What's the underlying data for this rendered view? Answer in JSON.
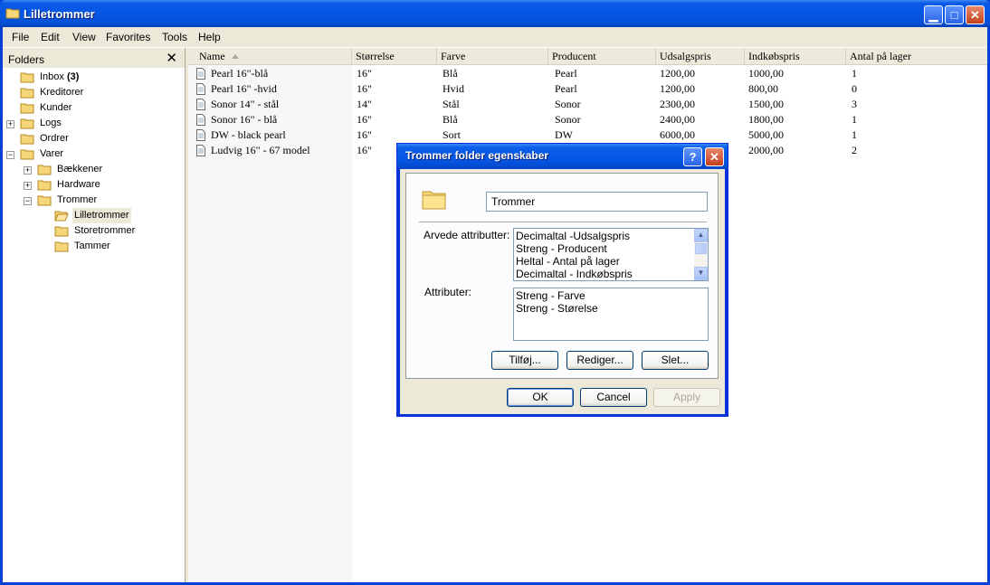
{
  "window": {
    "title": "Lilletrommer"
  },
  "menu": [
    "File",
    "Edit",
    "View",
    "Favorites",
    "Tools",
    "Help"
  ],
  "folders": {
    "title": "Folders",
    "close_glyph": "✕",
    "tree": [
      {
        "label": "Inbox",
        "count": "(3)"
      },
      {
        "label": "Kreditorer"
      },
      {
        "label": "Kunder"
      },
      {
        "label": "Logs"
      },
      {
        "label": "Ordrer"
      },
      {
        "label": "Varer"
      },
      {
        "label": "Bækkener"
      },
      {
        "label": "Hardware"
      },
      {
        "label": "Trommer"
      },
      {
        "label": "Lilletrommer"
      },
      {
        "label": "Storetrommer"
      },
      {
        "label": "Tammer"
      }
    ]
  },
  "table": {
    "columns": [
      "Name",
      "Størrelse",
      "Farve",
      "Producent",
      "Udsalgspris",
      "Indkøbspris",
      "Antal på lager"
    ],
    "rows": [
      [
        "Pearl 16\"-blå",
        "16\"",
        "Blå",
        "Pearl",
        "1200,00",
        "1000,00",
        "1"
      ],
      [
        "Pearl 16\" -hvid",
        "16\"",
        "Hvid",
        "Pearl",
        "1200,00",
        "800,00",
        "0"
      ],
      [
        "Sonor 14\" - stål",
        "14\"",
        "Stål",
        "Sonor",
        "2300,00",
        "1500,00",
        "3"
      ],
      [
        "Sonor 16\" - blå",
        "16\"",
        "Blå",
        "Sonor",
        "2400,00",
        "1800,00",
        "1"
      ],
      [
        "DW - black pearl",
        "16\"",
        "Sort",
        "DW",
        "6000,00",
        "5000,00",
        "1"
      ],
      [
        "Ludvig 16\" - 67 model",
        "16\"",
        "",
        "",
        "",
        "2000,00",
        "2"
      ]
    ]
  },
  "dialog": {
    "title": "Trommer folder egenskaber",
    "name_value": "Trommer",
    "inherited_label": "Arvede attributter:",
    "inherited": [
      "Decimaltal -Udsalgspris",
      "Streng - Producent",
      "Heltal - Antal på lager",
      "Decimaltal - Indkøbspris"
    ],
    "attributes_label": "Attributer:",
    "attributes": [
      "Streng - Farve",
      "Streng - Størelse"
    ],
    "add_button": "Tilføj...",
    "edit_button": "Rediger...",
    "delete_button": "Slet...",
    "ok_button": "OK",
    "cancel_button": "Cancel",
    "apply_button": "Apply"
  },
  "colors": {
    "titlebar": "#0657e6",
    "close": "#c2401b",
    "chrome": "#ece9d8"
  }
}
